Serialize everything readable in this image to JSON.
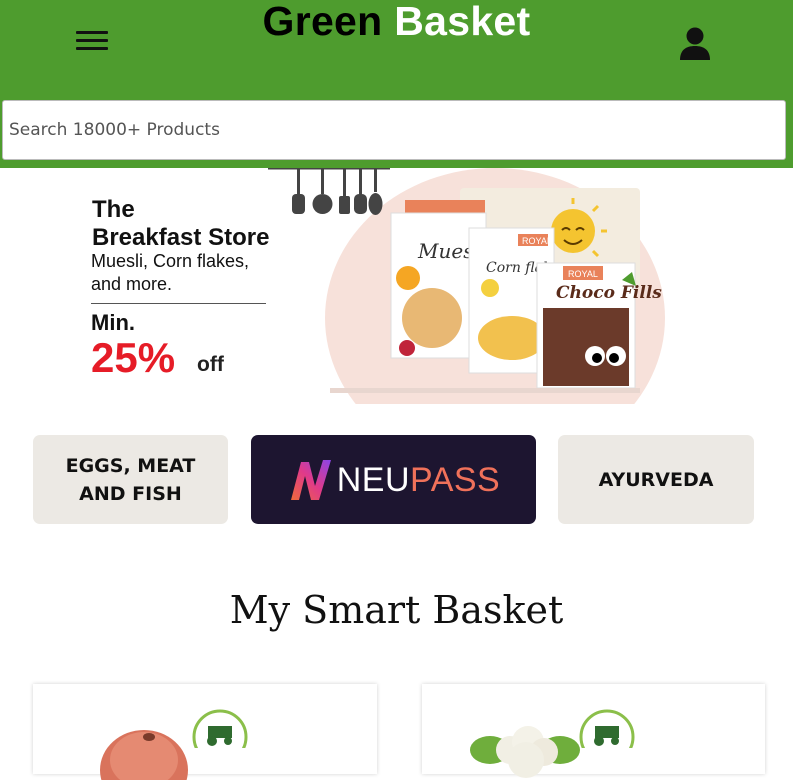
{
  "header": {
    "brand_part1": "Green",
    "brand_part2": "Basket",
    "bg_color": "#4e9c2e"
  },
  "search": {
    "placeholder": "Search 18000+ Products"
  },
  "banner": {
    "title_line1": "The",
    "title_line2": "Breakfast Store",
    "subtitle": "Muesli, Corn flakes, and more.",
    "min_label": "Min.",
    "discount": "25%",
    "off": "off",
    "products": [
      "Muesli",
      "Corn flakes",
      "Choco Fills"
    ],
    "brand_badge": "ROYAL"
  },
  "categories": [
    {
      "label": "EGGS, MEAT AND FISH"
    },
    {
      "label_neu": "NEU",
      "label_pass": "PASS"
    },
    {
      "label": "AYURVEDA"
    }
  ],
  "section": {
    "title": "My Smart Basket"
  },
  "colors": {
    "accent_red": "#e61c27",
    "neupass_bg": "#1d1530",
    "tile_bg": "#ece9e4"
  }
}
